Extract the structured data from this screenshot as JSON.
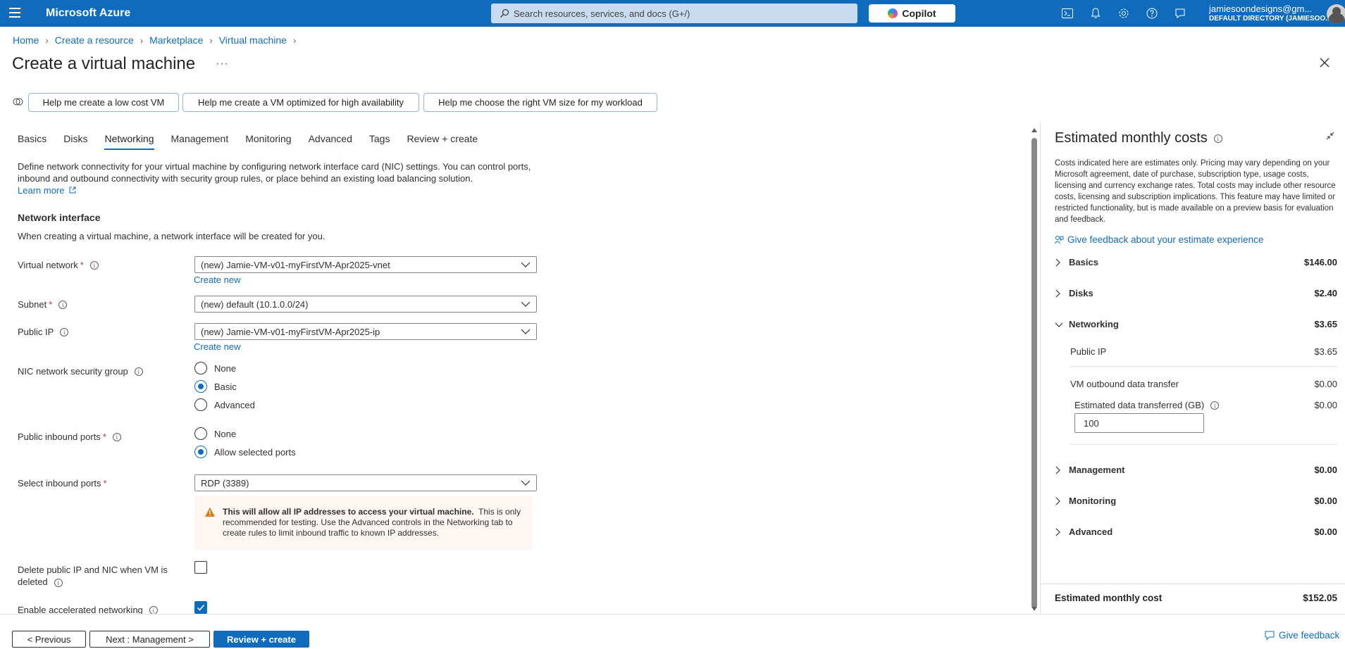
{
  "header": {
    "brand": "Microsoft Azure",
    "search_placeholder": "Search resources, services, and docs (G+/)",
    "copilot_label": "Copilot",
    "account_name": "jamiesoondesigns@gm...",
    "account_directory": "DEFAULT DIRECTORY (JAMIESOO..."
  },
  "breadcrumb": [
    "Home",
    "Create a resource",
    "Marketplace",
    "Virtual machine"
  ],
  "page": {
    "title": "Create a virtual machine",
    "more": "···"
  },
  "suggestions": [
    "Help me create a low cost VM",
    "Help me create a VM optimized for high availability",
    "Help me choose the right VM size for my workload"
  ],
  "tabs": [
    "Basics",
    "Disks",
    "Networking",
    "Management",
    "Monitoring",
    "Advanced",
    "Tags",
    "Review + create"
  ],
  "active_tab": "Networking",
  "networking": {
    "description": "Define network connectivity for your virtual machine by configuring network interface card (NIC) settings. You can control ports, inbound and outbound connectivity with security group rules, or place behind an existing load balancing solution.",
    "learn_more": "Learn more",
    "section_title": "Network interface",
    "section_subtitle": "When creating a virtual machine, a network interface will be created for you.",
    "virtual_network_label": "Virtual network",
    "virtual_network_value": "(new) Jamie-VM-v01-myFirstVM-Apr2025-vnet",
    "create_new": "Create new",
    "subnet_label": "Subnet",
    "subnet_value": "(new) default (10.1.0.0/24)",
    "public_ip_label": "Public IP",
    "public_ip_value": "(new) Jamie-VM-v01-myFirstVM-Apr2025-ip",
    "nic_nsg_label": "NIC network security group",
    "nic_nsg_options": [
      "None",
      "Basic",
      "Advanced"
    ],
    "nic_nsg_selected": "Basic",
    "inbound_ports_label": "Public inbound ports",
    "inbound_ports_options": [
      "None",
      "Allow selected ports"
    ],
    "inbound_ports_selected": "Allow selected ports",
    "select_ports_label": "Select inbound ports",
    "select_ports_value": "RDP (3389)",
    "warning_bold": "This will allow all IP addresses to access your virtual machine.",
    "warning_rest": "This is only recommended for testing.  Use the Advanced controls in the Networking tab to create rules to limit inbound traffic to known IP addresses.",
    "delete_label": "Delete public IP and NIC when VM is deleted",
    "delete_checked": false,
    "accel_label": "Enable accelerated networking",
    "accel_checked": true
  },
  "costs": {
    "title": "Estimated monthly costs",
    "description": "Costs indicated here are estimates only. Pricing may vary depending on your Microsoft agreement, date of purchase, subscription type, usage costs, licensing and currency exchange rates. Total costs may include other resource costs, licensing and subscription implications. This feature may have limited or restricted functionality, but is made available on a preview basis for evaluation and feedback.",
    "feedback": "Give feedback about your estimate experience",
    "rows": {
      "basics": {
        "name": "Basics",
        "amount": "$146.00"
      },
      "disks": {
        "name": "Disks",
        "amount": "$2.40"
      },
      "networking": {
        "name": "Networking",
        "amount": "$3.65"
      },
      "management": {
        "name": "Management",
        "amount": "$0.00"
      },
      "monitoring": {
        "name": "Monitoring",
        "amount": "$0.00"
      },
      "advanced": {
        "name": "Advanced",
        "amount": "$0.00"
      }
    },
    "public_ip": {
      "name": "Public IP",
      "amount": "$3.65"
    },
    "outbound": {
      "name": "VM outbound data transfer",
      "amount": "$0.00"
    },
    "est_data": {
      "name": "Estimated data transferred (GB)",
      "amount": "$0.00",
      "value": "100"
    },
    "total_label": "Estimated monthly cost",
    "total_amount": "$152.05"
  },
  "footer": {
    "previous": "< Previous",
    "next": "Next : Management >",
    "review": "Review + create",
    "feedback": "Give feedback"
  },
  "colors": {
    "accent": "#0f6cbd",
    "topbar": "#0f6cbd",
    "warning_bg": "#fdf6f3",
    "warning_icon": "#da7b11"
  }
}
